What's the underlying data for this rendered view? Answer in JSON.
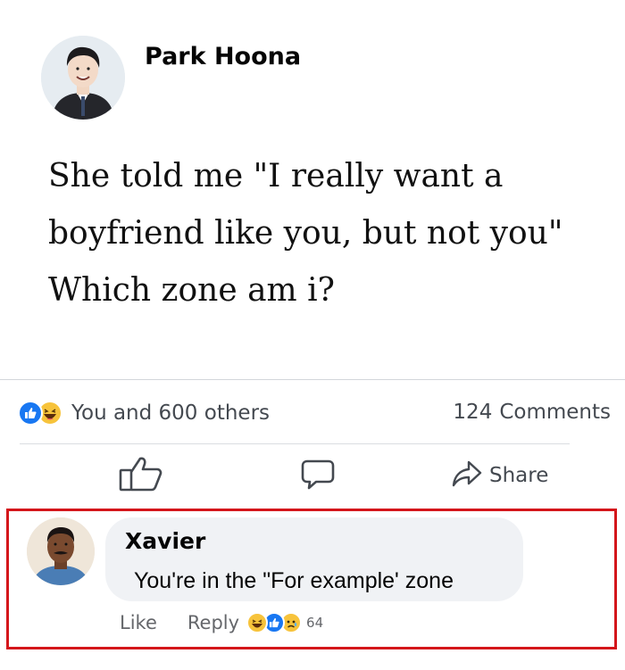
{
  "post": {
    "author": "Park Hoona",
    "text": "She told me \"I really want a\nboyfriend like you, but not you\"\nWhich zone am i?"
  },
  "stats": {
    "reactions_text": "You and 600 others",
    "comments_number": "124",
    "comments_label": "Comments"
  },
  "actions": {
    "share_label": "Share"
  },
  "comment": {
    "author": "Xavier",
    "text": "You're in the \"For example' zone",
    "like_label": "Like",
    "reply_label": "Reply",
    "reaction_count": "64"
  },
  "colors": {
    "facebook_blue": "#1877f2",
    "highlight_red": "#d4161b",
    "reaction_yellow": "#f7c33b",
    "secondary_text": "#65676b"
  }
}
